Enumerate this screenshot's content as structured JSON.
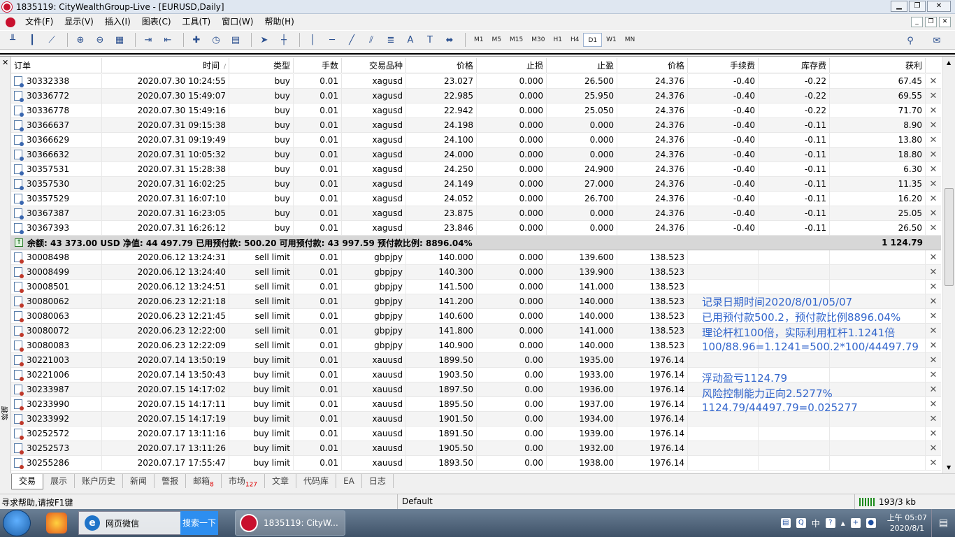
{
  "window": {
    "title": "1835119: CityWealthGroup-Live - [EURUSD,Daily]"
  },
  "menu": [
    "文件(F)",
    "显示(V)",
    "插入(I)",
    "图表(C)",
    "工具(T)",
    "窗口(W)",
    "帮助(H)"
  ],
  "toolbar": {
    "timeframes": [
      "M1",
      "M5",
      "M15",
      "M30",
      "H1",
      "H4",
      "D1",
      "W1",
      "MN"
    ],
    "active_timeframe": "D1"
  },
  "table": {
    "headers": [
      "订单",
      "时间",
      "类型",
      "手数",
      "交易品种",
      "价格",
      "止损",
      "止盈",
      "价格",
      "手续费",
      "库存费",
      "获利"
    ],
    "sort_mark": "/",
    "open_rows": [
      [
        "30332338",
        "2020.07.30 10:24:55",
        "buy",
        "0.01",
        "xagusd",
        "23.027",
        "0.000",
        "26.500",
        "24.376",
        "-0.40",
        "-0.22",
        "67.45"
      ],
      [
        "30336772",
        "2020.07.30 15:49:07",
        "buy",
        "0.01",
        "xagusd",
        "22.985",
        "0.000",
        "25.950",
        "24.376",
        "-0.40",
        "-0.22",
        "69.55"
      ],
      [
        "30336778",
        "2020.07.30 15:49:16",
        "buy",
        "0.01",
        "xagusd",
        "22.942",
        "0.000",
        "25.050",
        "24.376",
        "-0.40",
        "-0.22",
        "71.70"
      ],
      [
        "30366637",
        "2020.07.31 09:15:38",
        "buy",
        "0.01",
        "xagusd",
        "24.198",
        "0.000",
        "0.000",
        "24.376",
        "-0.40",
        "-0.11",
        "8.90"
      ],
      [
        "30366629",
        "2020.07.31 09:19:49",
        "buy",
        "0.01",
        "xagusd",
        "24.100",
        "0.000",
        "0.000",
        "24.376",
        "-0.40",
        "-0.11",
        "13.80"
      ],
      [
        "30366632",
        "2020.07.31 10:05:32",
        "buy",
        "0.01",
        "xagusd",
        "24.000",
        "0.000",
        "0.000",
        "24.376",
        "-0.40",
        "-0.11",
        "18.80"
      ],
      [
        "30357531",
        "2020.07.31 15:28:38",
        "buy",
        "0.01",
        "xagusd",
        "24.250",
        "0.000",
        "24.900",
        "24.376",
        "-0.40",
        "-0.11",
        "6.30"
      ],
      [
        "30357530",
        "2020.07.31 16:02:25",
        "buy",
        "0.01",
        "xagusd",
        "24.149",
        "0.000",
        "27.000",
        "24.376",
        "-0.40",
        "-0.11",
        "11.35"
      ],
      [
        "30357529",
        "2020.07.31 16:07:10",
        "buy",
        "0.01",
        "xagusd",
        "24.052",
        "0.000",
        "26.700",
        "24.376",
        "-0.40",
        "-0.11",
        "16.20"
      ],
      [
        "30367387",
        "2020.07.31 16:23:05",
        "buy",
        "0.01",
        "xagusd",
        "23.875",
        "0.000",
        "0.000",
        "24.376",
        "-0.40",
        "-0.11",
        "25.05"
      ],
      [
        "30367393",
        "2020.07.31 16:26:12",
        "buy",
        "0.01",
        "xagusd",
        "23.846",
        "0.000",
        "0.000",
        "24.376",
        "-0.40",
        "-0.11",
        "26.50"
      ]
    ],
    "summary": {
      "text": "余额: 43 373.00 USD  净值: 44 497.79  已用预付款: 500.20  可用预付款: 43 997.59  预付款比例: 8896.04%",
      "profit": "1 124.79"
    },
    "pending_rows": [
      [
        "30008498",
        "2020.06.12 13:24:31",
        "sell limit",
        "0.01",
        "gbpjpy",
        "140.000",
        "0.000",
        "139.600",
        "138.523"
      ],
      [
        "30008499",
        "2020.06.12 13:24:40",
        "sell limit",
        "0.01",
        "gbpjpy",
        "140.300",
        "0.000",
        "139.900",
        "138.523"
      ],
      [
        "30008501",
        "2020.06.12 13:24:51",
        "sell limit",
        "0.01",
        "gbpjpy",
        "141.500",
        "0.000",
        "141.000",
        "138.523"
      ],
      [
        "30080062",
        "2020.06.23 12:21:18",
        "sell limit",
        "0.01",
        "gbpjpy",
        "141.200",
        "0.000",
        "140.000",
        "138.523"
      ],
      [
        "30080063",
        "2020.06.23 12:21:45",
        "sell limit",
        "0.01",
        "gbpjpy",
        "140.600",
        "0.000",
        "140.000",
        "138.523"
      ],
      [
        "30080072",
        "2020.06.23 12:22:00",
        "sell limit",
        "0.01",
        "gbpjpy",
        "141.800",
        "0.000",
        "141.000",
        "138.523"
      ],
      [
        "30080083",
        "2020.06.23 12:22:09",
        "sell limit",
        "0.01",
        "gbpjpy",
        "140.900",
        "0.000",
        "140.000",
        "138.523"
      ],
      [
        "30221003",
        "2020.07.14 13:50:19",
        "buy limit",
        "0.01",
        "xauusd",
        "1899.50",
        "0.00",
        "1935.00",
        "1976.14"
      ],
      [
        "30221006",
        "2020.07.14 13:50:43",
        "buy limit",
        "0.01",
        "xauusd",
        "1903.50",
        "0.00",
        "1933.00",
        "1976.14"
      ],
      [
        "30233987",
        "2020.07.15 14:17:02",
        "buy limit",
        "0.01",
        "xauusd",
        "1897.50",
        "0.00",
        "1936.00",
        "1976.14"
      ],
      [
        "30233990",
        "2020.07.15 14:17:11",
        "buy limit",
        "0.01",
        "xauusd",
        "1895.50",
        "0.00",
        "1937.00",
        "1976.14"
      ],
      [
        "30233992",
        "2020.07.15 14:17:19",
        "buy limit",
        "0.01",
        "xauusd",
        "1901.50",
        "0.00",
        "1934.00",
        "1976.14"
      ],
      [
        "30252572",
        "2020.07.17 13:11:16",
        "buy limit",
        "0.01",
        "xauusd",
        "1891.50",
        "0.00",
        "1939.00",
        "1976.14"
      ],
      [
        "30252573",
        "2020.07.17 13:11:26",
        "buy limit",
        "0.01",
        "xauusd",
        "1905.50",
        "0.00",
        "1932.00",
        "1976.14"
      ],
      [
        "30255286",
        "2020.07.17 17:55:47",
        "buy limit",
        "0.01",
        "xauusd",
        "1893.50",
        "0.00",
        "1938.00",
        "1976.14"
      ]
    ]
  },
  "annotations": [
    "记录日期时间2020/8/01/05/07",
    "已用预付款500.2，预付款比例8896.04%",
    "理论杆杠100倍，实际利用杠杆1.1241倍",
    "100/88.96=1.1241=500.2*100/44497.79",
    "浮动盈亏1124.79",
    "风险控制能力正向2.5277%",
    "1124.79/44497.79=0.025277"
  ],
  "side_label": "终端",
  "tabs": [
    {
      "label": "交易",
      "badge": ""
    },
    {
      "label": "展示",
      "badge": ""
    },
    {
      "label": "账户历史",
      "badge": ""
    },
    {
      "label": "新闻",
      "badge": ""
    },
    {
      "label": "警报",
      "badge": ""
    },
    {
      "label": "邮箱",
      "badge": "8"
    },
    {
      "label": "市场",
      "badge": "127"
    },
    {
      "label": "文章",
      "badge": ""
    },
    {
      "label": "代码库",
      "badge": ""
    },
    {
      "label": "EA",
      "badge": ""
    },
    {
      "label": "日志",
      "badge": ""
    }
  ],
  "status": {
    "help": "寻求帮助,请按F1键",
    "profile": "Default",
    "traffic": "193/3 kb"
  },
  "taskbar": {
    "ie_label": "网页微信",
    "search_label": "搜索一下",
    "active_app": "1835119: CityW...",
    "lang": "中",
    "time": "上午 05:07",
    "date": "2020/8/1"
  }
}
